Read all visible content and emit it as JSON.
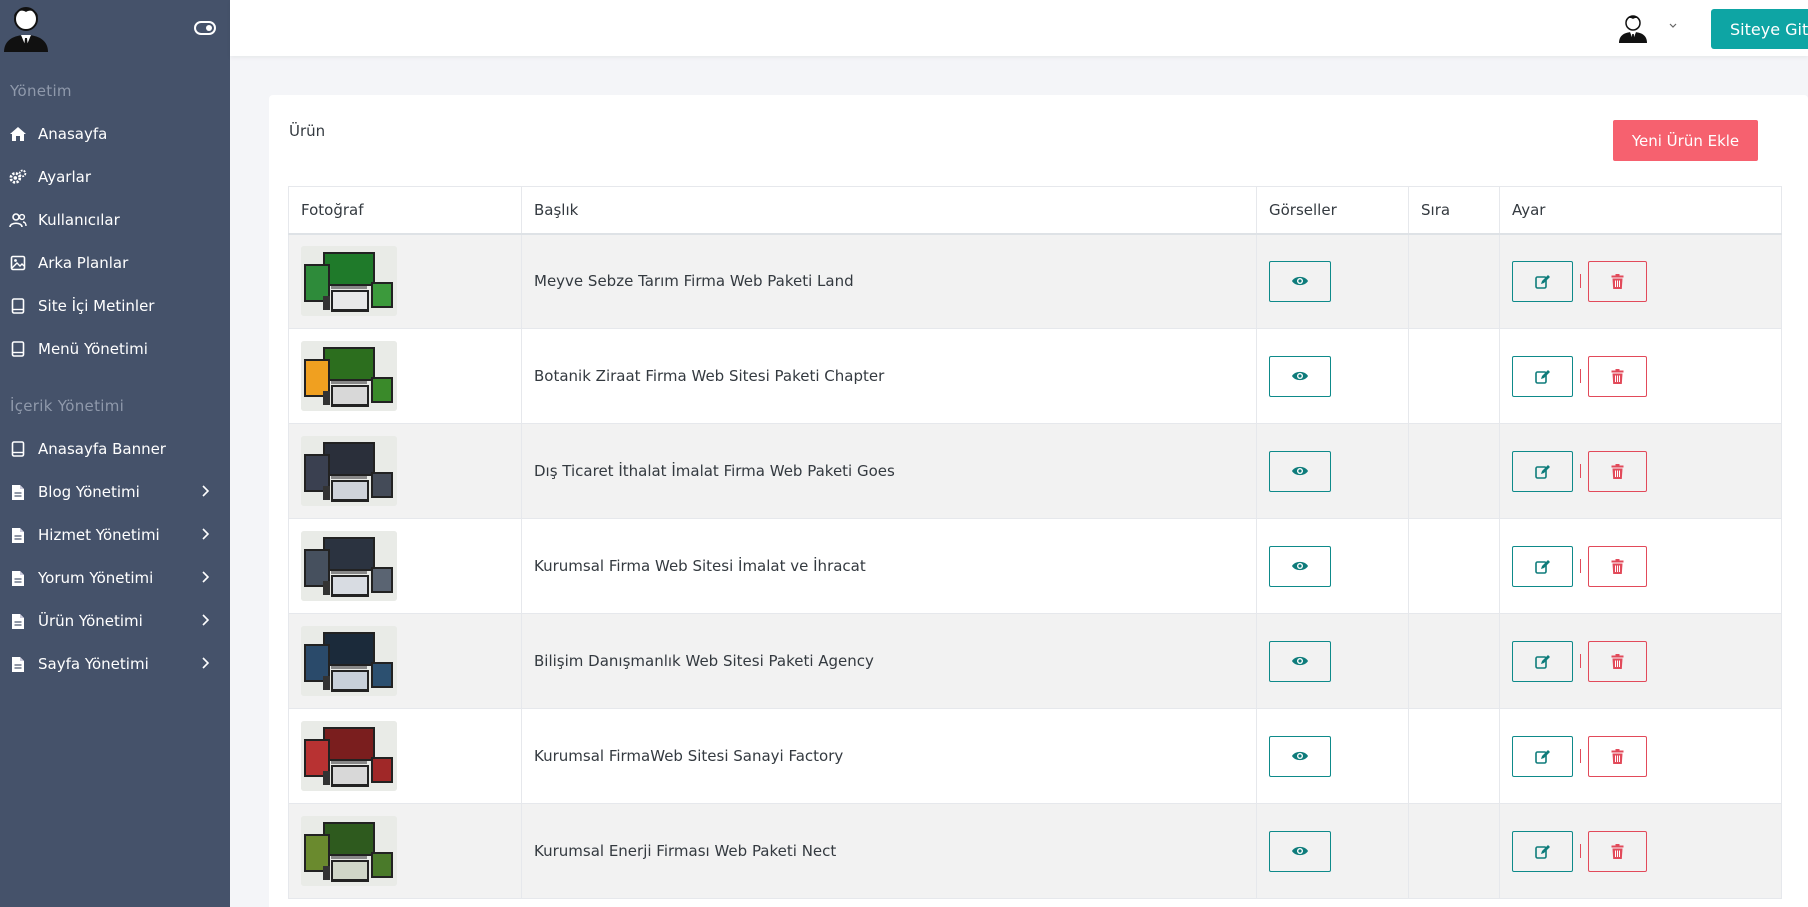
{
  "sidebar": {
    "section1": "Yönetim",
    "items1": [
      {
        "label": "Anasayfa",
        "icon": "home-icon"
      },
      {
        "label": "Ayarlar",
        "icon": "gears-icon"
      },
      {
        "label": "Kullanıcılar",
        "icon": "users-icon"
      },
      {
        "label": "Arka Planlar",
        "icon": "image-icon"
      },
      {
        "label": "Site İçi Metinler",
        "icon": "book-icon"
      },
      {
        "label": "Menü Yönetimi",
        "icon": "book-icon"
      }
    ],
    "section2": "İçerik Yönetimi",
    "items2": [
      {
        "label": "Anasayfa Banner",
        "icon": "book-icon"
      },
      {
        "label": "Blog Yönetimi",
        "icon": "file-icon"
      },
      {
        "label": "Hizmet Yönetimi",
        "icon": "file-icon"
      },
      {
        "label": "Yorum Yönetimi",
        "icon": "file-icon"
      },
      {
        "label": "Ürün Yönetimi",
        "icon": "file-icon"
      },
      {
        "label": "Sayfa Yönetimi",
        "icon": "file-icon"
      }
    ]
  },
  "topbar": {
    "button": "Siteye Git"
  },
  "card": {
    "title": "Ürün",
    "add_button": "Yeni Ürün Ekle",
    "columns": [
      "Fotoğraf",
      "Başlık",
      "Görseller",
      "Sıra",
      "Ayar"
    ],
    "rows": [
      {
        "title": "Meyve Sebze Tarım Firma Web Paketi Land",
        "sira": ""
      },
      {
        "title": "Botanik Ziraat Firma Web Sitesi Paketi Chapter",
        "sira": ""
      },
      {
        "title": "Dış Ticaret İthalat İmalat Firma Web Paketi Goes",
        "sira": ""
      },
      {
        "title": "Kurumsal Firma Web Sitesi İmalat ve İhracat",
        "sira": ""
      },
      {
        "title": "Bilişim Danışmanlık Web Sitesi Paketi Agency",
        "sira": ""
      },
      {
        "title": "Kurumsal FirmaWeb Sitesi Sanayi Factory",
        "sira": ""
      },
      {
        "title": "Kurumsal Enerji Firması Web Paketi Nect",
        "sira": ""
      }
    ]
  },
  "colors": {
    "sidebar": "#45526a",
    "teal": "#0ea5a4",
    "pink": "#f6616f",
    "danger": "#e24a5a"
  }
}
